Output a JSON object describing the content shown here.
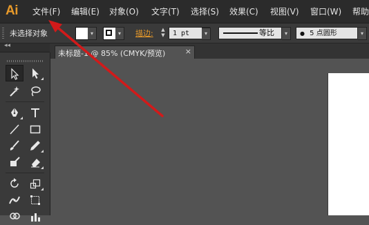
{
  "app": {
    "logo": "Ai"
  },
  "menubar": {
    "items": [
      {
        "label": "文件(F)"
      },
      {
        "label": "编辑(E)"
      },
      {
        "label": "对象(O)"
      },
      {
        "label": "文字(T)"
      },
      {
        "label": "选择(S)"
      },
      {
        "label": "效果(C)"
      },
      {
        "label": "视图(V)"
      },
      {
        "label": "窗口(W)"
      },
      {
        "label": "帮助"
      }
    ]
  },
  "controlbar": {
    "selection_label": "未选择对象",
    "fill_color": "#ffffff",
    "stroke_label": "描边:",
    "stroke_weight": "1 pt",
    "stroke_style_label": "等比",
    "brush_label": "5 点圆形",
    "brush_bullet": "●",
    "accent_color": "#e89a2a"
  },
  "document": {
    "tab_title": "未标题-1 @ 85% (CMYK/预览)",
    "close_glyph": "×"
  },
  "annotation": {
    "arrow_color": "#d21a1a"
  }
}
